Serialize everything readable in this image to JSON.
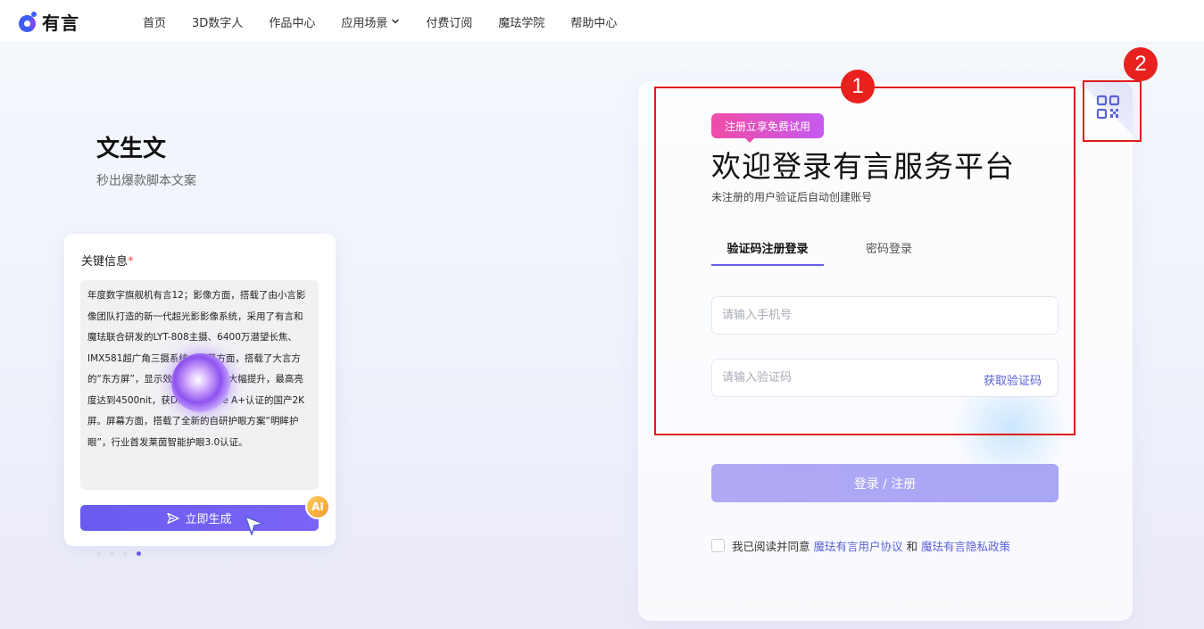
{
  "brand": {
    "name": "有言"
  },
  "nav": {
    "items": [
      "首页",
      "3D数字人",
      "作品中心",
      "应用场景",
      "付费订阅",
      "魔珐学院",
      "帮助中心"
    ]
  },
  "showcase": {
    "title": "文生文",
    "subtitle": "秒出爆款脚本文案",
    "card_label": "关键信息",
    "required_mark": "*",
    "card_text": "年度数字旗舰机有言12；影像方面，搭载了由小言影像团队打造的新一代超光影影像系统，采用了有言和魔珐联合研发的LYT-808主摄、6400万潜望长焦、IMX581超广角三摄系统。屏幕方面，搭载了大言方的“东方屏”，显示效果和亮度有了大幅提升，最高亮度达到4500nit，获DisplayMate A+认证的国产2K屏。屏幕方面，搭载了全新的自研护眼方案“明眸护眼”，行业首发莱茵智能护眼3.0认证。",
    "generate_button": "立即生成",
    "ai_badge": "AI",
    "carousel_active_index": 3,
    "carousel_count": 4
  },
  "login": {
    "promo_badge": "注册立享免费试用",
    "title": "欢迎登录有言服务平台",
    "hint": "未注册的用户验证后自动创建账号",
    "tabs": [
      "验证码注册登录",
      "密码登录"
    ],
    "active_tab": "验证码注册登录",
    "phone_placeholder": "请输入手机号",
    "code_placeholder": "请输入验证码",
    "get_code": "获取验证码",
    "submit": "登录 / 注册",
    "agree_prefix": "我已阅读并同意",
    "agree_link1": "魔珐有言用户协议",
    "agree_and": "和",
    "agree_link2": "魔珐有言隐私政策"
  },
  "annotations": {
    "marker1": "1",
    "marker2": "2",
    "color": "#e01b1b"
  },
  "colors": {
    "accent": "#6a5cf0",
    "link": "#5a62d8",
    "promo_start": "#f04ca7",
    "promo_end": "#c65af0"
  }
}
